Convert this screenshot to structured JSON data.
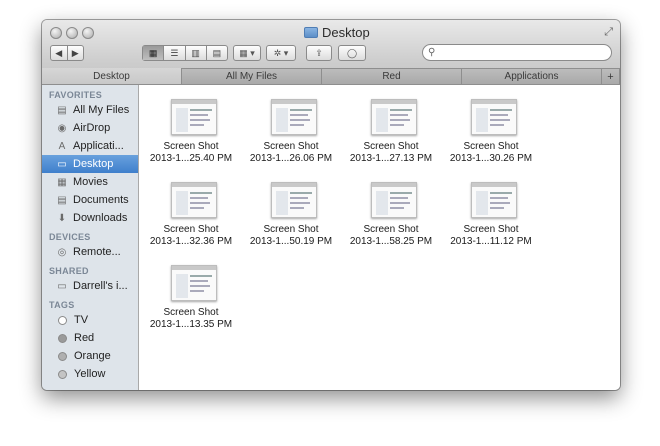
{
  "window": {
    "title": "Desktop"
  },
  "toolbar": {
    "back_label": "◀",
    "forward_label": "▶",
    "views": [
      "▦",
      "☰",
      "▥",
      "▤"
    ],
    "arrange_label": "▦ ▾",
    "action_label": "✲ ▾",
    "share_label": "⇪",
    "tag_label": "◯",
    "search_placeholder": ""
  },
  "tabs": [
    {
      "label": "Desktop",
      "active": true
    },
    {
      "label": "All My Files",
      "active": false
    },
    {
      "label": "Red",
      "active": false
    },
    {
      "label": "Applications",
      "active": false
    }
  ],
  "sidebar": {
    "favorites_header": "FAVORITES",
    "favorites": [
      {
        "label": "All My Files",
        "icon": "all-files-icon",
        "glyph": "▤"
      },
      {
        "label": "AirDrop",
        "icon": "airdrop-icon",
        "glyph": "◉"
      },
      {
        "label": "Applicati...",
        "icon": "applications-icon",
        "glyph": "A"
      },
      {
        "label": "Desktop",
        "icon": "desktop-icon",
        "glyph": "▭",
        "selected": true
      },
      {
        "label": "Movies",
        "icon": "movies-icon",
        "glyph": "▦"
      },
      {
        "label": "Documents",
        "icon": "documents-icon",
        "glyph": "▤"
      },
      {
        "label": "Downloads",
        "icon": "downloads-icon",
        "glyph": "⬇"
      }
    ],
    "devices_header": "DEVICES",
    "devices": [
      {
        "label": "Remote...",
        "icon": "disc-icon",
        "glyph": "◎"
      }
    ],
    "shared_header": "SHARED",
    "shared": [
      {
        "label": "Darrell's i...",
        "icon": "computer-icon",
        "glyph": "▭"
      }
    ],
    "tags_header": "TAGS",
    "tags": [
      {
        "label": "TV",
        "color": "#ffffff"
      },
      {
        "label": "Red",
        "color": "#9a9a9a"
      },
      {
        "label": "Orange",
        "color": "#b0b0b0"
      },
      {
        "label": "Yellow",
        "color": "#c4c4c4"
      }
    ]
  },
  "files": [
    {
      "line1": "Screen Shot",
      "line2": "2013-1...25.40 PM"
    },
    {
      "line1": "Screen Shot",
      "line2": "2013-1...26.06 PM"
    },
    {
      "line1": "Screen Shot",
      "line2": "2013-1...27.13 PM"
    },
    {
      "line1": "Screen Shot",
      "line2": "2013-1...30.26 PM"
    },
    {
      "line1": "Screen Shot",
      "line2": "2013-1...32.36 PM"
    },
    {
      "line1": "Screen Shot",
      "line2": "2013-1...50.19 PM"
    },
    {
      "line1": "Screen Shot",
      "line2": "2013-1...58.25 PM"
    },
    {
      "line1": "Screen Shot",
      "line2": "2013-1...11.12 PM"
    },
    {
      "line1": "Screen Shot",
      "line2": "2013-1...13.35 PM"
    }
  ]
}
